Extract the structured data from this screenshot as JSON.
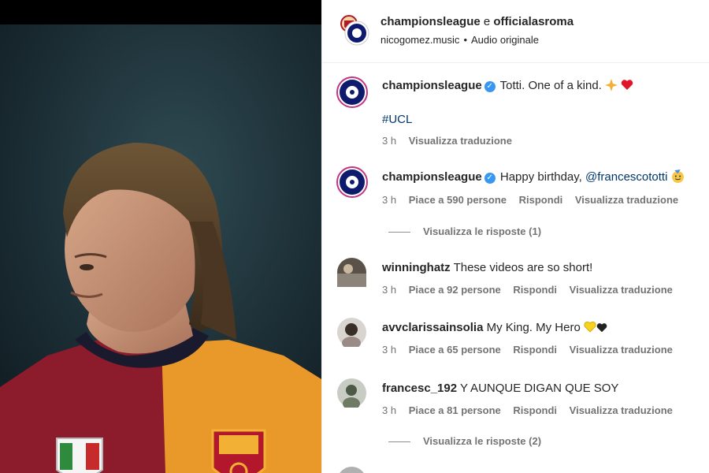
{
  "header": {
    "account_1": "championsleague",
    "conjunction": "e",
    "account_2": "officialasroma",
    "audio_user": "nicogomez.music",
    "audio_label": "Audio originale"
  },
  "caption": {
    "user": "championsleague",
    "text": "Totti. One of a kind.",
    "hashtag": "#UCL",
    "time": "3 h",
    "translate": "Visualizza traduzione"
  },
  "comments": [
    {
      "user": "championsleague",
      "text": "Happy birthday,",
      "mention": "@francescototti",
      "time": "3 h",
      "likes": "Piace a 590 persone",
      "reply": "Rispondi",
      "translate": "Visualizza traduzione",
      "view_replies": "Visualizza le risposte (1)"
    },
    {
      "user": "winninghatz",
      "text": "These videos are so short!",
      "time": "3 h",
      "likes": "Piace a 92 persone",
      "reply": "Rispondi",
      "translate": "Visualizza traduzione"
    },
    {
      "user": "avvclarissainsolia",
      "text": "My King. My Hero",
      "time": "3 h",
      "likes": "Piace a 65 persone",
      "reply": "Rispondi",
      "translate": "Visualizza traduzione"
    },
    {
      "user": "francesc_192",
      "text": "Y AUNQUE DIGAN QUE SOY",
      "time": "3 h",
      "likes": "Piace a 81 persone",
      "reply": "Rispondi",
      "translate": "Visualizza traduzione",
      "view_replies": "Visualizza le risposte (2)"
    }
  ],
  "colors": {
    "link": "#00376b",
    "meta": "#737373",
    "verified": "#3897f0",
    "jersey_red": "#8c1c2c",
    "jersey_orange": "#e8992a"
  }
}
